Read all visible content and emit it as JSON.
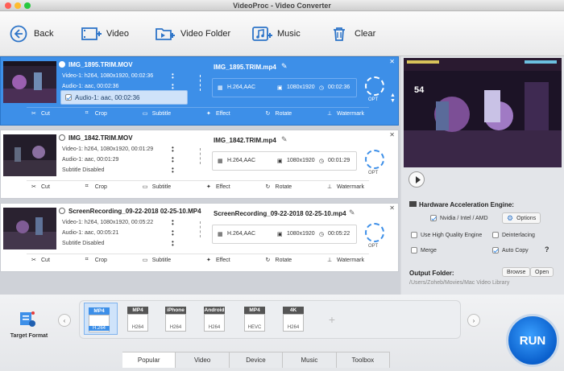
{
  "window": {
    "title": "VideoProc - Video Converter"
  },
  "toolbar": {
    "back": "Back",
    "video": "Video",
    "video_folder": "Video Folder",
    "music": "Music",
    "clear": "Clear"
  },
  "actions": {
    "cut": "Cut",
    "crop": "Crop",
    "subtitle": "Subtitle",
    "effect": "Effect",
    "rotate": "Rotate",
    "watermark": "Watermark"
  },
  "opt_label": "OPT",
  "items": [
    {
      "name": "IMG_1895.TRIM.MOV",
      "video": "Video-1: h264, 1080x1920, 00:02:36",
      "audio": "Audio-1: aac, 00:02:36",
      "third": "",
      "out_name": "IMG_1895.TRIM.mp4",
      "codec": "H.264,AAC",
      "res": "1080x1920",
      "dur": "00:02:36"
    },
    {
      "name": "IMG_1842.TRIM.MOV",
      "video": "Video-1: h264, 1080x1920, 00:01:29",
      "audio": "Audio-1: aac, 00:01:29",
      "third": "Subtitle Disabled",
      "out_name": "IMG_1842.TRIM.mp4",
      "codec": "H.264,AAC",
      "res": "1080x1920",
      "dur": "00:01:29"
    },
    {
      "name": "ScreenRecording_09-22-2018 02-25-10.MP4",
      "video": "Video-1: h264, 1080x1920, 00:05:22",
      "audio": "Audio-1: aac, 00:05:21",
      "third": "Subtitle Disabled",
      "out_name": "ScreenRecording_09-22-2018 02-25-10.mp4",
      "codec": "H.264,AAC",
      "res": "1080x1920",
      "dur": "00:05:22"
    }
  ],
  "audio_dropdown": {
    "option": "Audio-1: aac, 00:02:36"
  },
  "preview": {
    "score": "54"
  },
  "hw": {
    "title": "Hardware Acceleration Engine:",
    "nvidia": "Nvidia / Intel / AMD",
    "options": "Options",
    "high_quality": "Use High Quality Engine",
    "deinterlacing": "Deinterlacing",
    "merge": "Merge",
    "auto_copy": "Auto Copy",
    "help": "?"
  },
  "output": {
    "label": "Output Folder:",
    "path": "/Users/Zoheb/Movies/Mac Video Library",
    "browse": "Browse",
    "open": "Open"
  },
  "target_format": {
    "label": "Target Format"
  },
  "formats": [
    {
      "tag": "MP4",
      "sub": "H.264"
    },
    {
      "tag": "MP4",
      "sub": "H264"
    },
    {
      "tag": "iPhone",
      "sub": "H264"
    },
    {
      "tag": "Android",
      "sub": "H264"
    },
    {
      "tag": "MP4",
      "sub": "HEVC"
    },
    {
      "tag": "4K",
      "sub": "H264"
    }
  ],
  "tabs": [
    "Popular",
    "Video",
    "Device",
    "Music",
    "Toolbox"
  ],
  "run": "RUN",
  "colors": {
    "accent": "#3d8fe8",
    "run": "#0a5fcc"
  }
}
